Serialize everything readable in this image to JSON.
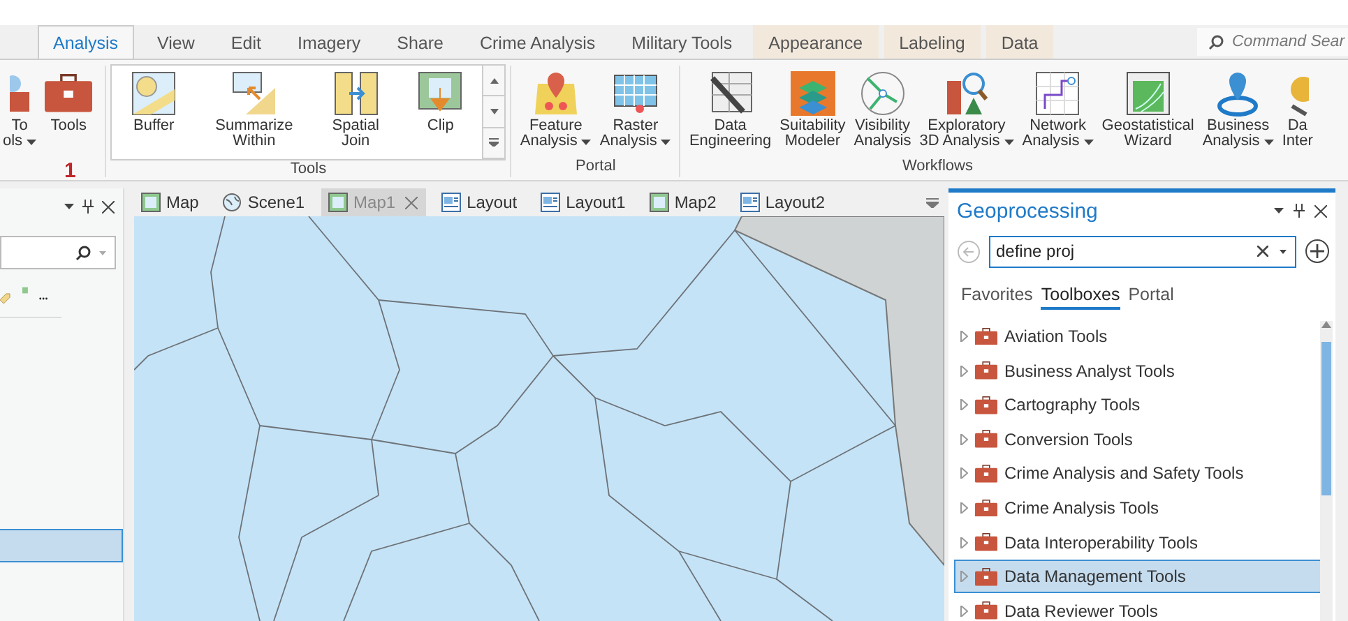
{
  "ribbon_tabs": [
    {
      "label": "Analysis",
      "selected": true,
      "contextual": false
    },
    {
      "label": "View",
      "selected": false,
      "contextual": false
    },
    {
      "label": "Edit",
      "selected": false,
      "contextual": false
    },
    {
      "label": "Imagery",
      "selected": false,
      "contextual": false
    },
    {
      "label": "Share",
      "selected": false,
      "contextual": false
    },
    {
      "label": "Crime Analysis",
      "selected": false,
      "contextual": false
    },
    {
      "label": "Military Tools",
      "selected": false,
      "contextual": false
    },
    {
      "label": "Appearance",
      "selected": false,
      "contextual": true
    },
    {
      "label": "Labeling",
      "selected": false,
      "contextual": true
    },
    {
      "label": "Data",
      "selected": false,
      "contextual": true
    }
  ],
  "command_search": {
    "placeholder": "Command Sear"
  },
  "ribbon_groups": [
    {
      "kind": "buttons",
      "buttons": [
        {
          "lines": [
            "To",
            "ols"
          ],
          "dropdown": true
        },
        {
          "lines": [
            "Tools"
          ],
          "dropdown": false
        }
      ]
    },
    {
      "kind": "gallery",
      "label": "Tools",
      "buttons": [
        {
          "lines": [
            "Buffer"
          ],
          "dropdown": false
        },
        {
          "lines": [
            "Summarize",
            "Within"
          ],
          "dropdown": false
        },
        {
          "lines": [
            "Spatial",
            "Join"
          ],
          "dropdown": false
        },
        {
          "lines": [
            "Clip"
          ],
          "dropdown": false
        }
      ]
    },
    {
      "kind": "buttons",
      "label": "Portal",
      "buttons": [
        {
          "lines": [
            "Feature",
            "Analysis"
          ],
          "dropdown": true
        },
        {
          "lines": [
            "Raster",
            "Analysis"
          ],
          "dropdown": true
        }
      ]
    },
    {
      "kind": "buttons",
      "label": "Workflows",
      "buttons": [
        {
          "lines": [
            "Data",
            "Engineering"
          ],
          "dropdown": false
        },
        {
          "lines": [
            "Suitability",
            "Modeler"
          ],
          "dropdown": false
        },
        {
          "lines": [
            "Visibility",
            "Analysis"
          ],
          "dropdown": false
        },
        {
          "lines": [
            "Exploratory",
            "3D Analysis"
          ],
          "dropdown": true
        },
        {
          "lines": [
            "Network",
            "Analysis"
          ],
          "dropdown": true
        },
        {
          "lines": [
            "Geostatistical",
            "Wizard"
          ],
          "dropdown": false
        },
        {
          "lines": [
            "Business",
            "Analysis"
          ],
          "dropdown": true
        },
        {
          "lines": [
            "Da",
            "Inter"
          ],
          "dropdown": false
        }
      ]
    }
  ],
  "badge": "1",
  "map_tabs": [
    {
      "label": "Map",
      "kind": "map",
      "selected": false
    },
    {
      "label": "Scene1",
      "kind": "scene",
      "selected": false
    },
    {
      "label": "Map1",
      "kind": "map",
      "selected": true
    },
    {
      "label": "Layout",
      "kind": "layout",
      "selected": false
    },
    {
      "label": "Layout1",
      "kind": "layout",
      "selected": false
    },
    {
      "label": "Map2",
      "kind": "map",
      "selected": false
    },
    {
      "label": "Layout2",
      "kind": "layout",
      "selected": false
    }
  ],
  "geoprocessing": {
    "title": "Geoprocessing",
    "search": {
      "value": "define proj"
    },
    "tabs": [
      {
        "label": "Favorites",
        "selected": false
      },
      {
        "label": "Toolboxes",
        "selected": true
      },
      {
        "label": "Portal",
        "selected": false
      }
    ],
    "toolboxes": [
      {
        "label": "Aviation Tools",
        "expanded": false,
        "selected": false
      },
      {
        "label": "Business Analyst Tools",
        "expanded": false,
        "selected": false
      },
      {
        "label": "Cartography Tools",
        "expanded": false,
        "selected": false
      },
      {
        "label": "Conversion Tools",
        "expanded": false,
        "selected": false
      },
      {
        "label": "Crime Analysis and Safety Tools",
        "expanded": false,
        "selected": false
      },
      {
        "label": "Crime Analysis Tools",
        "expanded": false,
        "selected": false
      },
      {
        "label": "Data Interoperability Tools",
        "expanded": false,
        "selected": false
      },
      {
        "label": "Data Management Tools",
        "expanded": false,
        "selected": true
      },
      {
        "label": "Data Reviewer Tools",
        "expanded": false,
        "selected": false
      }
    ]
  }
}
